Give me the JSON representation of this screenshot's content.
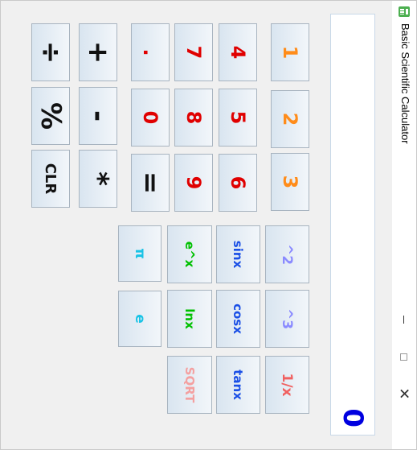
{
  "window": {
    "title": "Basic Scientific Calculator"
  },
  "display": {
    "value": "0"
  },
  "colors": {
    "accent_value": "#0000e0",
    "key_orange": "#ff8c1a",
    "key_red": "#e00000",
    "key_blue": "#1a4fe6",
    "key_lavender": "#8a8aff",
    "key_green": "#00c000",
    "key_cyan": "#19c3e6",
    "key_pink": "#f4a0a0"
  },
  "keys": {
    "pow2": "^2",
    "pow3": "^3",
    "recip": "1/x",
    "sin": "sinx",
    "cos": "cosx",
    "tan": "tanx",
    "exp": "e^x",
    "ln": "lnx",
    "sqrt": "SQRT",
    "pi": "π",
    "e": "e",
    "one": "1",
    "two": "2",
    "three": "3",
    "four": "4",
    "five": "5",
    "six": "6",
    "seven": "7",
    "eight": "8",
    "nine": "9",
    "dot": ".",
    "zero": "0",
    "equals": "=",
    "plus": "+",
    "minus": "-",
    "multiply": "*",
    "divide": "÷",
    "percent": "%",
    "clear": "CLR"
  }
}
